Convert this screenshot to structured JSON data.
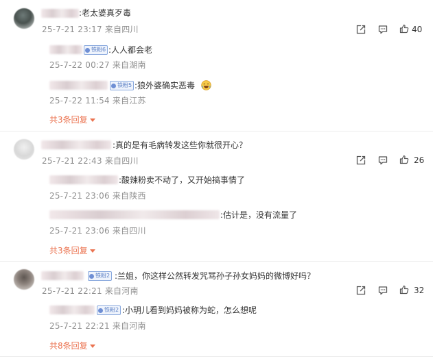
{
  "comments": [
    {
      "text": ":老太婆真歹毒",
      "meta": "25-7-21 23:17 来自四川",
      "likes": "40",
      "replies": [
        {
          "text": ":人人都会老",
          "badge": "铁粉6",
          "meta": "25-7-22 00:27 来自湖南"
        },
        {
          "text": ":狼外婆确实恶毒",
          "badge": "铁粉5",
          "meta": "25-7-22 11:54 来自江苏"
        }
      ],
      "more_label": "共3条回复"
    },
    {
      "text": ":真的是有毛病转发这些你就很开心？",
      "meta": "25-7-21 22:43 来自四川",
      "likes": "26",
      "replies": [
        {
          "text": ":酸辣粉卖不动了，又开始搞事情了",
          "meta": "25-7-21 23:06 来自陕西"
        },
        {
          "text": ":估计是，没有流量了",
          "meta": "25-7-21 23:06 来自四川"
        }
      ],
      "more_label": "共3条回复"
    },
    {
      "text": ":兰姐，你这样公然转发咒骂孙子孙女妈妈的微博好吗？",
      "badge": "铁粉2",
      "meta": "25-7-21 22:21 来自河南",
      "likes": "32",
      "replies": [
        {
          "text": ":小玥儿看到妈妈被称为蛇，怎么想呢",
          "badge": "铁粉2",
          "meta": "25-7-21 22:21 来自河南"
        }
      ],
      "more_label": "共8条回复"
    }
  ],
  "icons": [
    "share-icon",
    "comment-icon",
    "like-icon",
    "laughing-emoji-icon"
  ],
  "colors": {
    "accent": "#eb7350",
    "meta": "#8f8f8f",
    "badge": "#5b7fc4"
  }
}
